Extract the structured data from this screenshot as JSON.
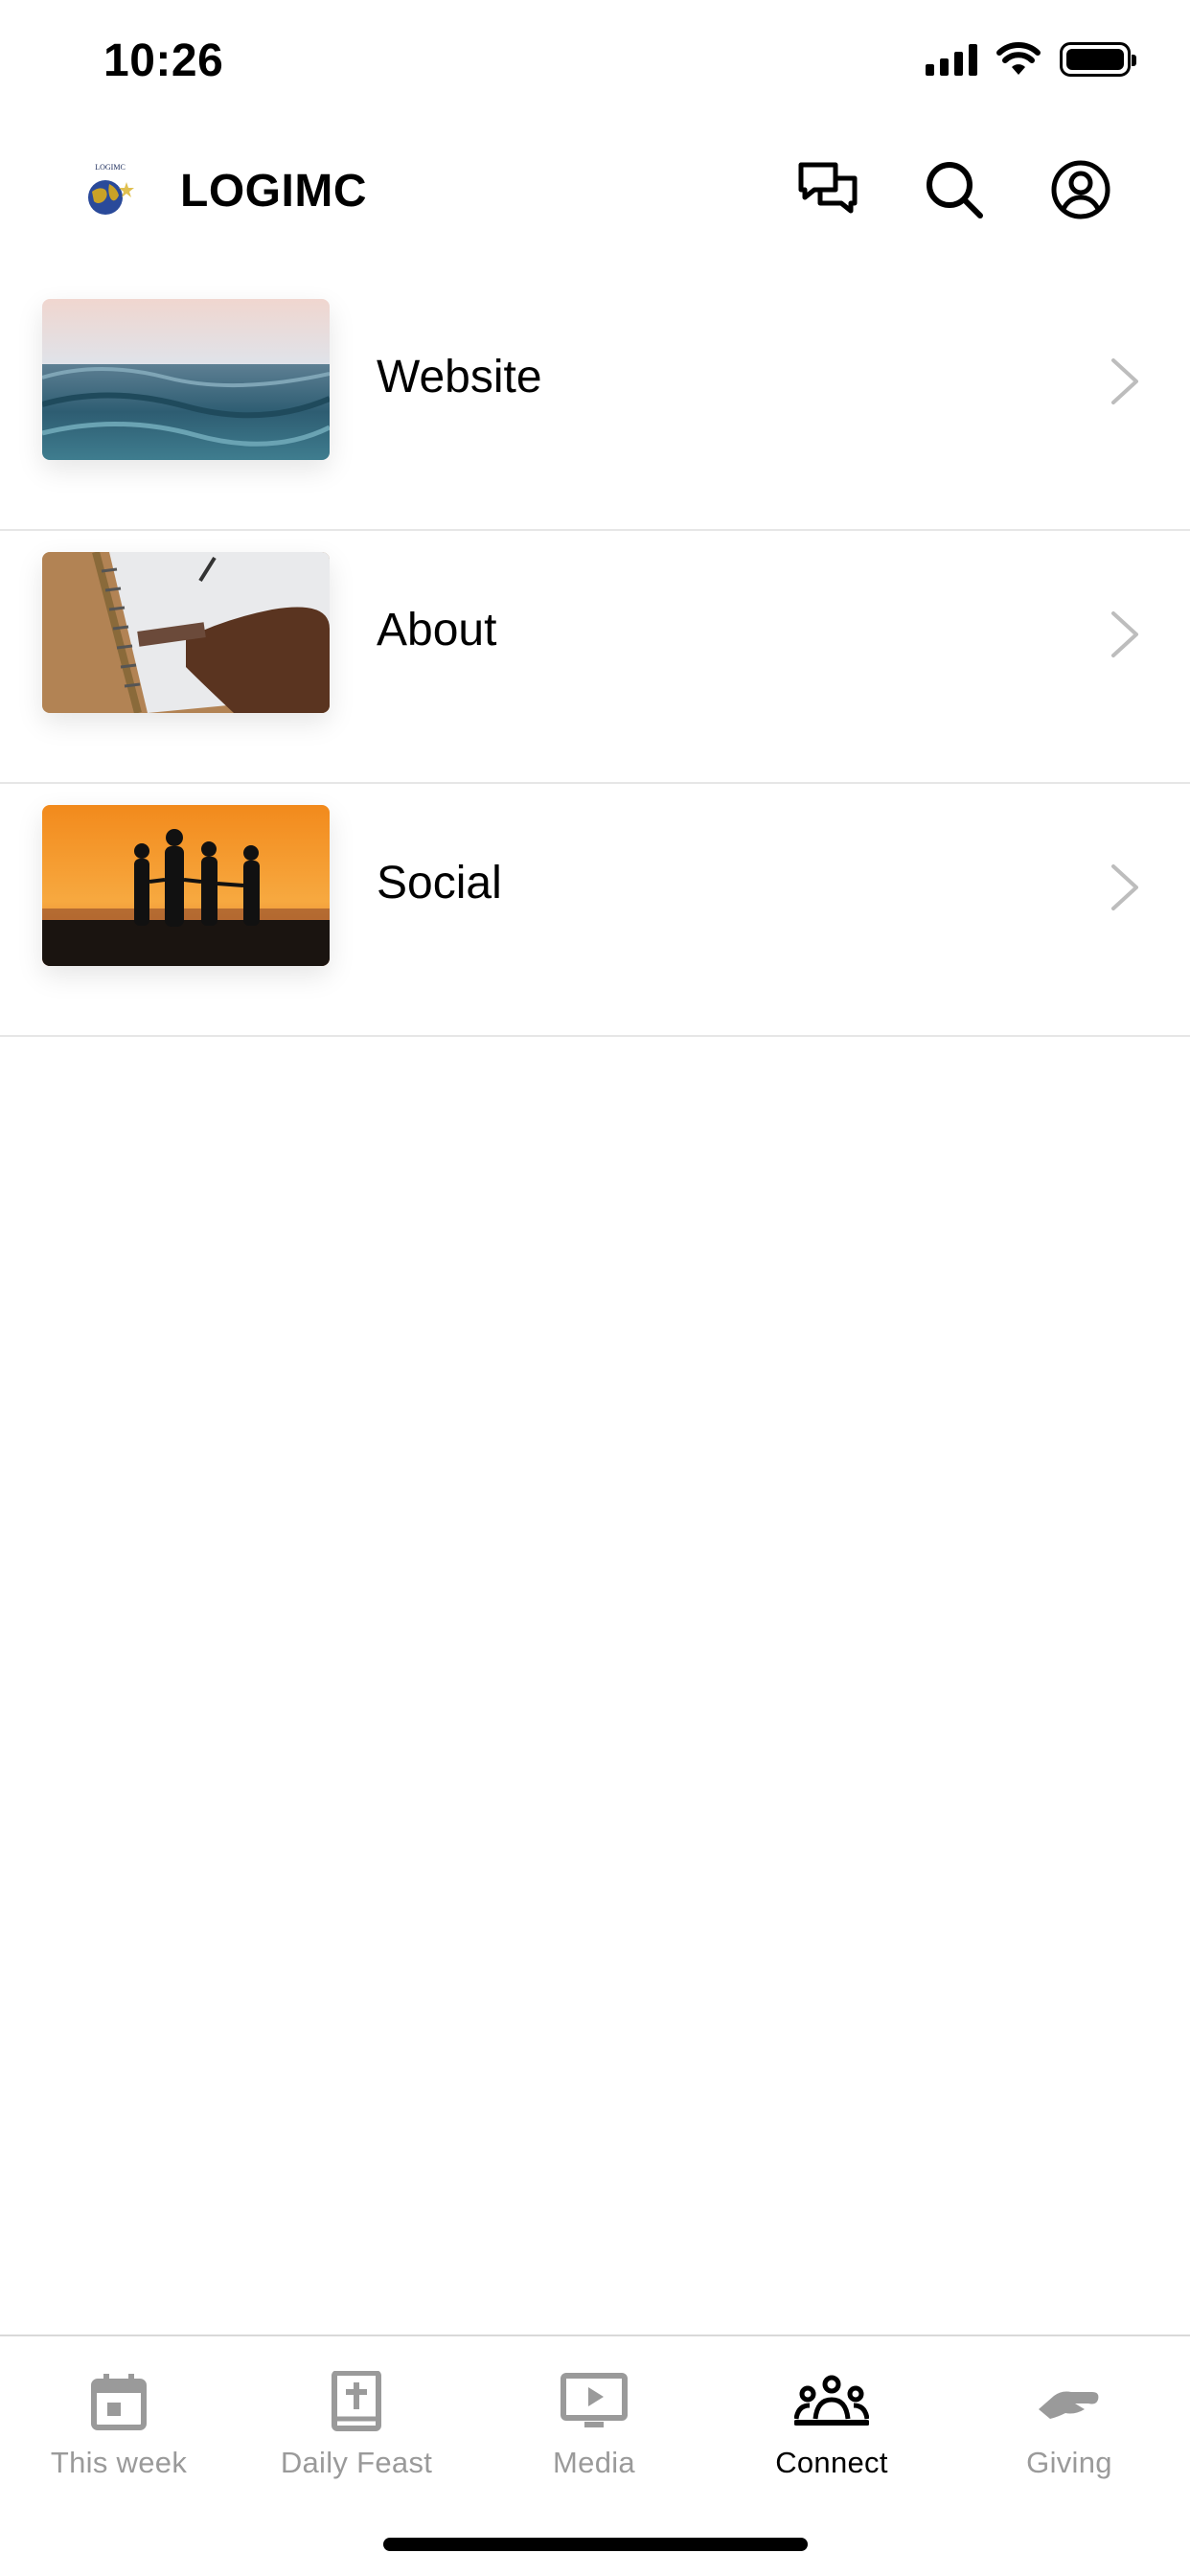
{
  "status_bar": {
    "time": "10:26"
  },
  "header": {
    "logo_text": "LOGIMC",
    "title": "LOGIMC",
    "icons": [
      "chat-icon",
      "search-icon",
      "profile-icon"
    ]
  },
  "list": {
    "items": [
      {
        "label": "Website",
        "thumbnail": "ocean-waves"
      },
      {
        "label": "About",
        "thumbnail": "notebook-writing"
      },
      {
        "label": "Social",
        "thumbnail": "sunset-silhouettes"
      }
    ]
  },
  "tabs": [
    {
      "label": "This week",
      "icon": "calendar-icon",
      "active": false
    },
    {
      "label": "Daily Feast",
      "icon": "bible-icon",
      "active": false
    },
    {
      "label": "Media",
      "icon": "play-screen-icon",
      "active": false
    },
    {
      "label": "Connect",
      "icon": "people-group-icon",
      "active": true
    },
    {
      "label": "Giving",
      "icon": "giving-hand-icon",
      "active": false
    }
  ],
  "colors": {
    "active_tab": "#000000",
    "inactive_tab": "#9a9a9a",
    "divider": "#e6e6e6"
  }
}
